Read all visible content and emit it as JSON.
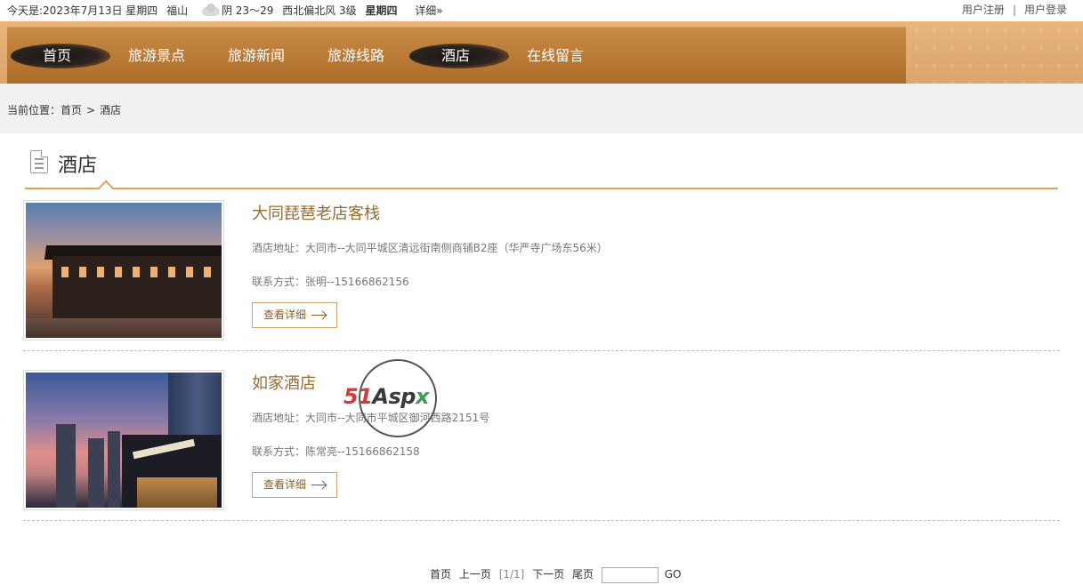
{
  "topbar": {
    "date": "今天是:2023年7月13日 星期四",
    "city": "福山",
    "weather": "阴 23～29",
    "wind": "西北偏北风 3级",
    "weekday": "星期四",
    "detail": "详细»",
    "register": "用户注册",
    "separator": "|",
    "login": "用户登录"
  },
  "nav": {
    "items": [
      {
        "label": "首页",
        "active": true
      },
      {
        "label": "旅游景点",
        "active": false
      },
      {
        "label": "旅游新闻",
        "active": false
      },
      {
        "label": "旅游线路",
        "active": false
      },
      {
        "label": "酒店",
        "active": true
      },
      {
        "label": "在线留言",
        "active": false
      }
    ]
  },
  "breadcrumb": {
    "prefix": "当前位置：",
    "home": "首页",
    "gt": ">",
    "current": "酒店"
  },
  "section": {
    "title": "酒店"
  },
  "hotels": [
    {
      "name": "大同琵琶老店客栈",
      "address": "酒店地址：大同市--大同平城区清远街南侧商铺B2座（华严寺广场东56米）",
      "contact": "联系方式：张明--15166862156",
      "button": "查看详细"
    },
    {
      "name": "如家酒店",
      "address": "酒店地址：大同市--大同市平城区御河西路2151号",
      "contact": "联系方式：陈常亮--15166862158",
      "button": "查看详细"
    }
  ],
  "watermark": {
    "part1": "51",
    "part2": "Asp",
    "part3": "x"
  },
  "pager": {
    "first": "首页",
    "prev": "上一页",
    "info": "[1/1]",
    "next": "下一页",
    "last": "尾页",
    "input_value": "",
    "go": "GO"
  },
  "colors": {
    "nav_bg": "#b97a35",
    "accent_line": "#d8a55a",
    "hotel_name": "#9a6a2f"
  }
}
